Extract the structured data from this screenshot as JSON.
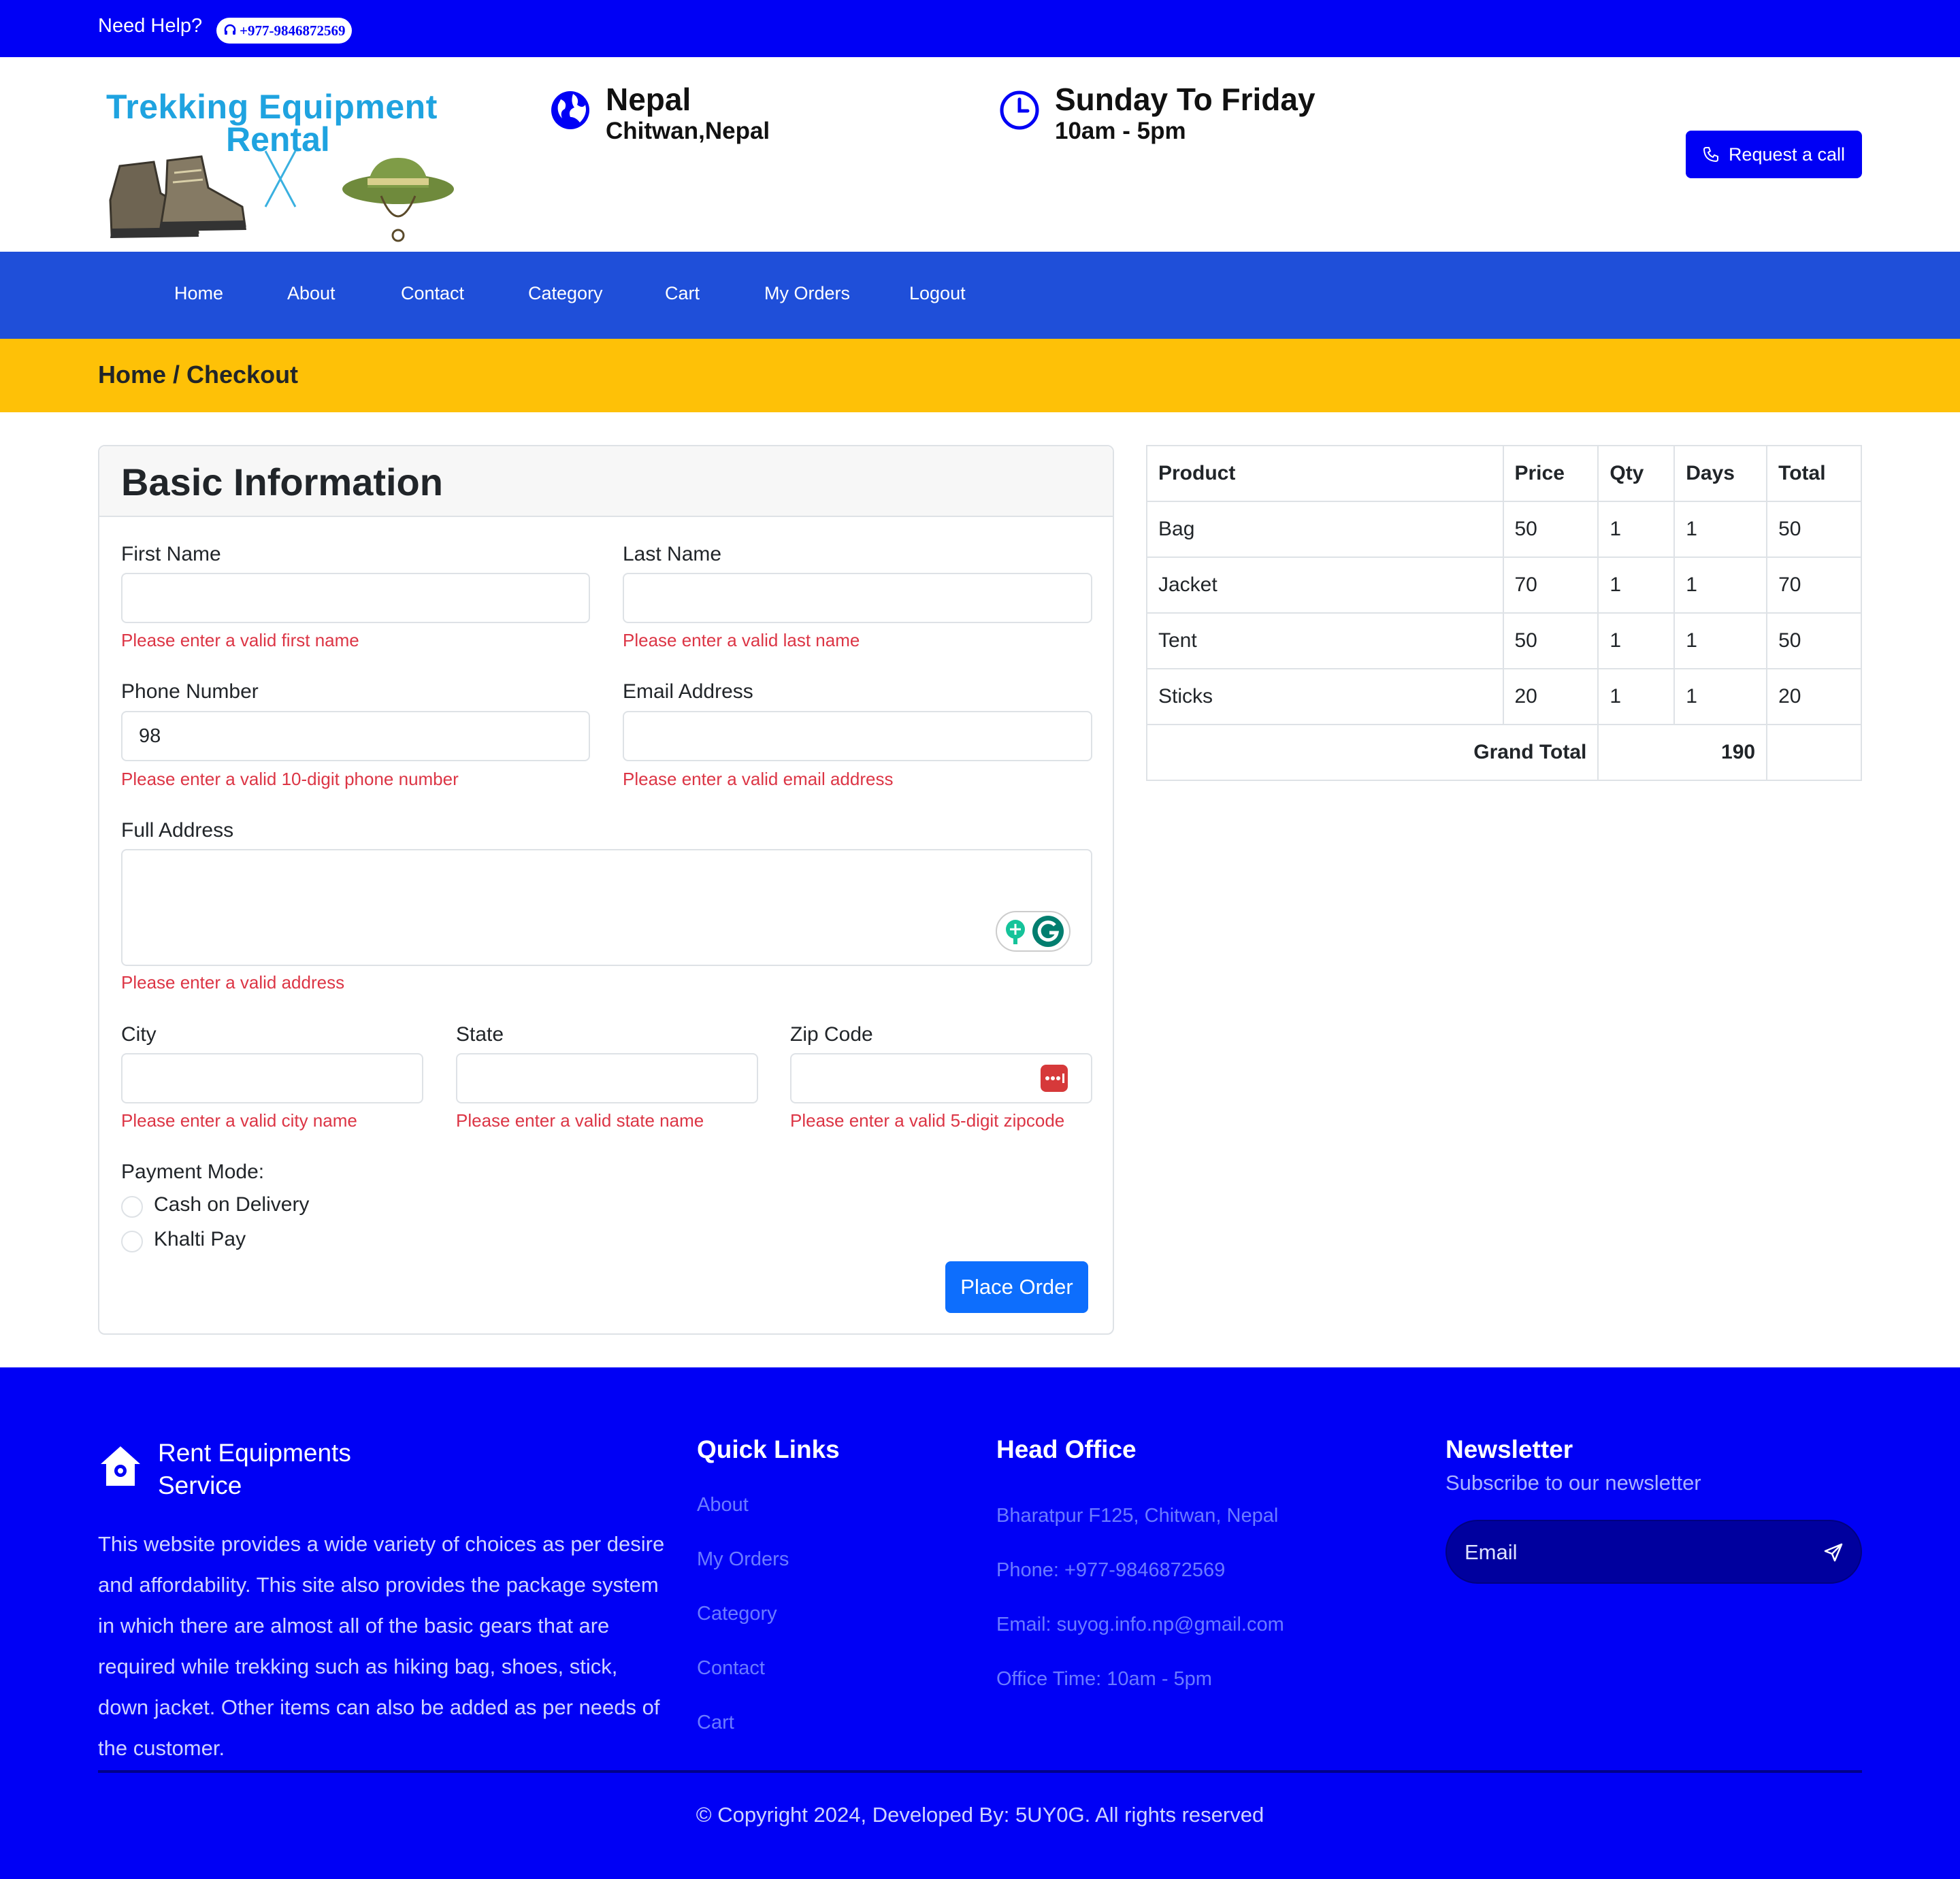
{
  "topbar": {
    "help": "Need Help?",
    "phone": "+977-9846872569"
  },
  "logo": {
    "line1": "Trekking Equipment",
    "line2": "Rental"
  },
  "location": {
    "title": "Nepal",
    "sub": "Chitwan,Nepal"
  },
  "hours": {
    "title": "Sunday To Friday",
    "sub": "10am - 5pm"
  },
  "request_call": "Request a call",
  "nav": [
    "Home",
    "About",
    "Contact",
    "Category",
    "Cart",
    "My Orders",
    "Logout"
  ],
  "breadcrumb": "Home / Checkout",
  "form": {
    "title": "Basic Information",
    "first_name": {
      "label": "First Name",
      "value": "",
      "error": "Please enter a valid first name"
    },
    "last_name": {
      "label": "Last Name",
      "value": "",
      "error": "Please enter a valid last name"
    },
    "phone": {
      "label": "Phone Number",
      "value": "98",
      "error": "Please enter a valid 10-digit phone number"
    },
    "email": {
      "label": "Email Address",
      "value": "",
      "error": "Please enter a valid email address"
    },
    "address": {
      "label": "Full Address",
      "value": "",
      "error": "Please enter a valid address"
    },
    "city": {
      "label": "City",
      "value": "",
      "error": "Please enter a valid city name"
    },
    "state": {
      "label": "State",
      "value": "",
      "error": "Please enter a valid state name"
    },
    "zip": {
      "label": "Zip Code",
      "value": "",
      "error": "Please enter a valid 5-digit zipcode"
    },
    "payment": {
      "label": "Payment Mode:",
      "options": [
        "Cash on Delivery",
        "Khalti Pay"
      ]
    },
    "submit": "Place Order"
  },
  "order": {
    "headers": [
      "Product",
      "Price",
      "Qty",
      "Days",
      "Total"
    ],
    "rows": [
      [
        "Bag",
        "50",
        "1",
        "1",
        "50"
      ],
      [
        "Jacket",
        "70",
        "1",
        "1",
        "70"
      ],
      [
        "Tent",
        "50",
        "1",
        "1",
        "50"
      ],
      [
        "Sticks",
        "20",
        "1",
        "1",
        "20"
      ]
    ],
    "grand_total_label": "Grand Total",
    "grand_total": "190"
  },
  "footer": {
    "brand": "Rent Equipments Service",
    "description": "This website provides a wide variety of choices as per desire and affordability. This site also provides the package system in which there are almost all of the basic gears that are required while trekking such as hiking bag, shoes, stick, down jacket. Other items can also be added as per needs of the customer.",
    "quick_links_title": "Quick Links",
    "quick_links": [
      "About",
      "My Orders",
      "Category",
      "Contact",
      "Cart"
    ],
    "office_title": "Head Office",
    "office": [
      "Bharatpur F125, Chitwan, Nepal",
      "Phone: +977-9846872569",
      "Email: suyog.info.np@gmail.com",
      "Office Time: 10am - 5pm"
    ],
    "newsletter_title": "Newsletter",
    "newsletter_sub": "Subscribe to our newsletter",
    "newsletter_placeholder": "Email",
    "copyright": "© Copyright 2024, Developed By: 5UY0G. All rights reserved"
  },
  "colors": {
    "primary": "#0000f5",
    "nav": "#1f4fd9",
    "breadcrumb": "#fec107",
    "button": "#0d6efd",
    "error": "#dc3545"
  }
}
